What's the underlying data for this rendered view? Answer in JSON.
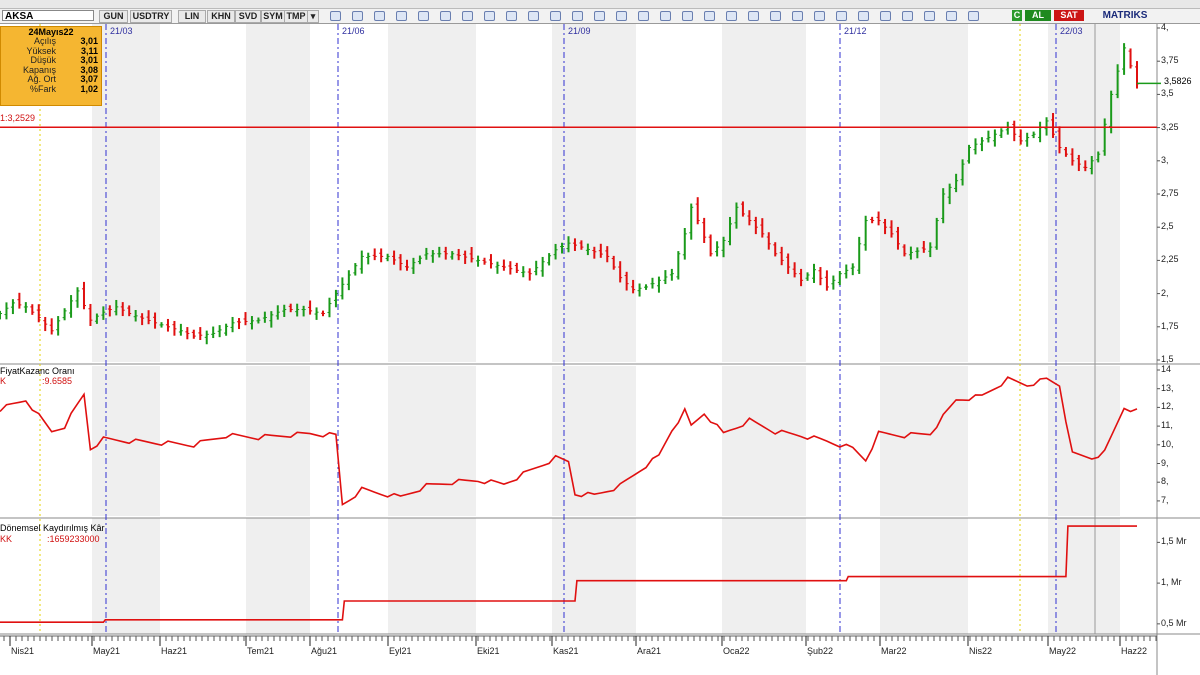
{
  "titlebar": {
    "title": "AKSA"
  },
  "toolbar": {
    "symbol": "AKSA",
    "buttons": [
      "GUN",
      "USDTRY",
      "LIN",
      "KHN",
      "SVD",
      "SYM",
      "TMP"
    ],
    "al_label": "AL",
    "sat_label": "SAT",
    "brand": "MATRIKS",
    "c_label": "C"
  },
  "info_box": {
    "date": "24Mayıs22",
    "rows": [
      {
        "label": "Açılış",
        "value": "3,01"
      },
      {
        "label": "Yüksek",
        "value": "3,11"
      },
      {
        "label": "Düşük",
        "value": "3,01"
      },
      {
        "label": "Kapanış",
        "value": "3,08"
      },
      {
        "label": "Ağ. Ort",
        "value": "3,07"
      },
      {
        "label": "%Fark",
        "value": "1,02"
      }
    ]
  },
  "h_line_label": "1:3,2529",
  "price_tag": "3,5826",
  "period_labels": [
    "21/03",
    "21/06",
    "21/09",
    "21/12",
    "22/03"
  ],
  "month_labels": [
    "Nis21",
    "May21",
    "Haz21",
    "Tem21",
    "Ağu21",
    "Eyl21",
    "Eki21",
    "Kas21",
    "Ara21",
    "Oca22",
    "Şub22",
    "Mar22",
    "Nis22",
    "May22",
    "Haz22"
  ],
  "panel2": {
    "title": "FiyatKazanc Oranı",
    "sub_label": "K",
    "value": ":9.6585"
  },
  "panel3": {
    "title": "Dönemsel Kaydırılmış Kâr",
    "sub_label": "KK",
    "value": ":1659233000"
  },
  "colors": {
    "up": "#1a9a1a",
    "down": "#e01010",
    "line": "#e01010",
    "dash": "#3030d0",
    "bg_band": "#efefef"
  },
  "chart_data": [
    {
      "type": "bar",
      "name": "AKSA",
      "yaxis_ticks": [
        "4,",
        "3,75",
        "3,5",
        "3,25",
        "3,",
        "2,75",
        "2,5",
        "2,25",
        "2,",
        "1,75",
        "1,5"
      ],
      "ylim": [
        1.5,
        4.0
      ],
      "hline": 3.2529,
      "last_price": 3.5826,
      "anchors": [
        [
          0,
          1.85
        ],
        [
          2,
          1.93
        ],
        [
          4,
          1.9
        ],
        [
          6,
          1.82
        ],
        [
          8,
          1.72
        ],
        [
          10,
          1.87
        ],
        [
          12,
          2.02
        ],
        [
          14,
          1.8
        ],
        [
          16,
          1.86
        ],
        [
          18,
          1.9
        ],
        [
          20,
          1.85
        ],
        [
          24,
          1.78
        ],
        [
          28,
          1.72
        ],
        [
          30,
          1.68
        ],
        [
          33,
          1.7
        ],
        [
          36,
          1.78
        ],
        [
          40,
          1.8
        ],
        [
          44,
          1.88
        ],
        [
          47,
          1.88
        ],
        [
          50,
          1.85
        ],
        [
          52,
          2.0
        ],
        [
          56,
          2.28
        ],
        [
          60,
          2.28
        ],
        [
          63,
          2.2
        ],
        [
          66,
          2.3
        ],
        [
          70,
          2.3
        ],
        [
          74,
          2.25
        ],
        [
          78,
          2.2
        ],
        [
          82,
          2.15
        ],
        [
          86,
          2.33
        ],
        [
          88,
          2.38
        ],
        [
          90,
          2.35
        ],
        [
          94,
          2.28
        ],
        [
          96,
          2.12
        ],
        [
          98,
          2.03
        ],
        [
          100,
          2.05
        ],
        [
          102,
          2.1
        ],
        [
          104,
          2.15
        ],
        [
          106,
          2.45
        ],
        [
          107,
          2.65
        ],
        [
          108,
          2.55
        ],
        [
          110,
          2.3
        ],
        [
          112,
          2.4
        ],
        [
          114,
          2.65
        ],
        [
          116,
          2.55
        ],
        [
          118,
          2.45
        ],
        [
          120,
          2.3
        ],
        [
          124,
          2.1
        ],
        [
          126,
          2.18
        ],
        [
          128,
          2.05
        ],
        [
          130,
          2.15
        ],
        [
          132,
          2.2
        ],
        [
          134,
          2.55
        ],
        [
          136,
          2.55
        ],
        [
          138,
          2.45
        ],
        [
          140,
          2.3
        ],
        [
          142,
          2.32
        ],
        [
          144,
          2.35
        ],
        [
          146,
          2.75
        ],
        [
          148,
          2.85
        ],
        [
          150,
          3.1
        ],
        [
          152,
          3.15
        ],
        [
          154,
          3.2
        ],
        [
          156,
          3.25
        ],
        [
          158,
          3.15
        ],
        [
          160,
          3.2
        ],
        [
          162,
          3.3
        ],
        [
          164,
          3.1
        ],
        [
          166,
          3.0
        ],
        [
          168,
          2.95
        ],
        [
          170,
          3.05
        ],
        [
          172,
          3.5
        ],
        [
          174,
          3.85
        ],
        [
          176,
          3.58
        ]
      ]
    },
    {
      "type": "line",
      "name": "FiyatKazanc Oranı",
      "yaxis_ticks": [
        "14",
        "13,",
        "12,",
        "11,",
        "10,",
        "9,",
        "8,",
        "7,"
      ],
      "ylim": [
        6.3,
        14.0
      ],
      "anchors": [
        [
          0,
          11.9
        ],
        [
          4,
          12.4
        ],
        [
          8,
          10.7
        ],
        [
          10,
          11.0
        ],
        [
          13,
          12.7
        ],
        [
          14,
          9.8
        ],
        [
          16,
          10.3
        ],
        [
          20,
          10.2
        ],
        [
          25,
          10.1
        ],
        [
          30,
          10.0
        ],
        [
          35,
          10.5
        ],
        [
          40,
          10.4
        ],
        [
          44,
          10.5
        ],
        [
          48,
          10.6
        ],
        [
          52,
          10.5
        ],
        [
          53,
          6.8
        ],
        [
          56,
          7.6
        ],
        [
          62,
          7.2
        ],
        [
          66,
          7.8
        ],
        [
          70,
          8.0
        ],
        [
          74,
          8.1
        ],
        [
          78,
          7.9
        ],
        [
          82,
          8.6
        ],
        [
          86,
          9.3
        ],
        [
          88,
          9.1
        ],
        [
          88.5,
          7.4
        ],
        [
          92,
          7.3
        ],
        [
          96,
          7.8
        ],
        [
          100,
          8.9
        ],
        [
          102,
          9.4
        ],
        [
          104,
          10.8
        ],
        [
          106,
          11.8
        ],
        [
          107,
          11.0
        ],
        [
          109,
          11.7
        ],
        [
          112,
          10.6
        ],
        [
          116,
          11.3
        ],
        [
          120,
          10.7
        ],
        [
          124,
          10.5
        ],
        [
          128,
          10.2
        ],
        [
          132,
          9.8
        ],
        [
          134,
          9.2
        ],
        [
          136,
          10.6
        ],
        [
          140,
          10.5
        ],
        [
          144,
          10.6
        ],
        [
          148,
          12.4
        ],
        [
          152,
          12.6
        ],
        [
          156,
          13.5
        ],
        [
          159,
          13.2
        ],
        [
          162,
          13.5
        ],
        [
          164,
          13.2
        ],
        [
          166,
          9.5
        ],
        [
          169,
          9.3
        ],
        [
          171,
          9.6
        ],
        [
          174,
          12.0
        ],
        [
          176,
          11.8
        ]
      ]
    },
    {
      "type": "line",
      "name": "Dönemsel Kaydırılmış Kâr",
      "yaxis_ticks": [
        "1,5 Mr",
        "1, Mr",
        "0,5 Mr"
      ],
      "ylim": [
        0.4,
        1.75
      ],
      "anchors": [
        [
          0,
          0.52
        ],
        [
          16,
          0.52
        ],
        [
          16.3,
          0.55
        ],
        [
          53,
          0.55
        ],
        [
          53.3,
          0.78
        ],
        [
          89,
          0.78
        ],
        [
          89.3,
          1.03
        ],
        [
          131,
          1.03
        ],
        [
          131.3,
          1.08
        ],
        [
          165,
          1.08
        ],
        [
          165.3,
          1.7
        ],
        [
          176,
          1.7
        ]
      ]
    }
  ]
}
